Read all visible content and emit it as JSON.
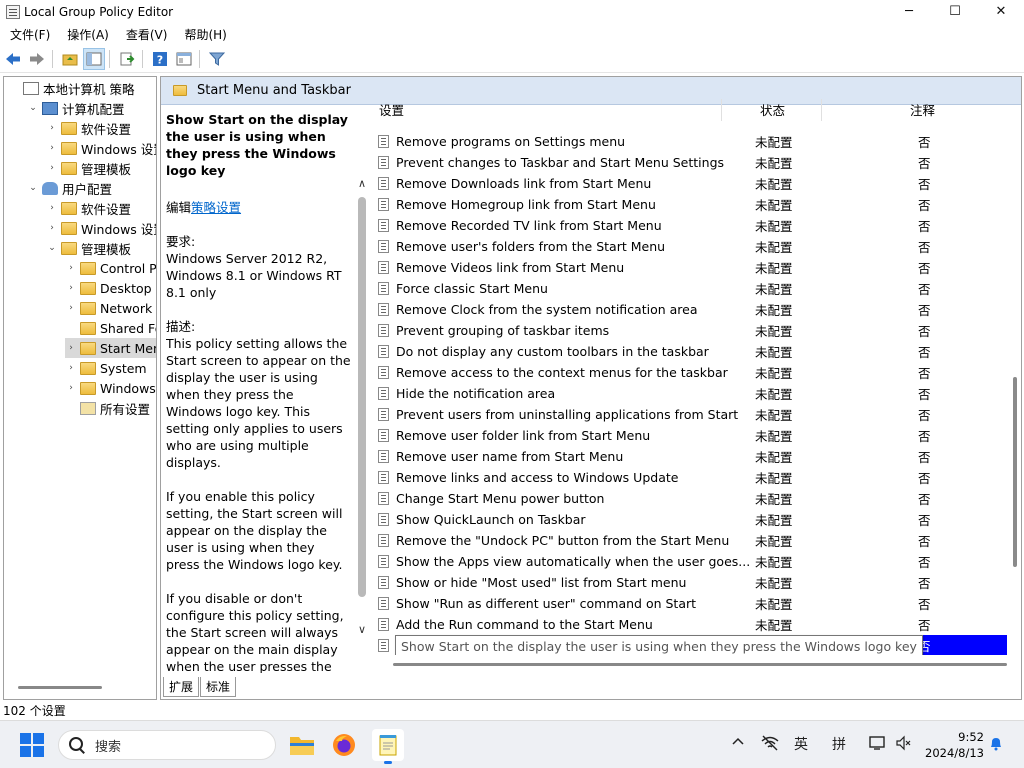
{
  "window": {
    "title": "Local Group Policy Editor",
    "controls": {
      "minimize": "─",
      "maximize": "☐",
      "close": "✕"
    }
  },
  "menu": [
    "文件(F)",
    "操作(A)",
    "查看(V)",
    "帮助(H)"
  ],
  "tree": {
    "items": [
      {
        "label": "本地计算机 策略",
        "depth": 0,
        "arrow": "",
        "icon": "computer-policy-icon"
      },
      {
        "label": "计算机配置",
        "depth": 1,
        "arrow": "⌄",
        "icon": "computer-icon"
      },
      {
        "label": "软件设置",
        "depth": 2,
        "arrow": "›",
        "icon": "folder-icon"
      },
      {
        "label": "Windows 设置",
        "depth": 2,
        "arrow": "›",
        "icon": "folder-icon"
      },
      {
        "label": "管理模板",
        "depth": 2,
        "arrow": "›",
        "icon": "folder-icon"
      },
      {
        "label": "用户配置",
        "depth": 1,
        "arrow": "⌄",
        "icon": "user-icon"
      },
      {
        "label": "软件设置",
        "depth": 2,
        "arrow": "›",
        "icon": "folder-icon"
      },
      {
        "label": "Windows 设置",
        "depth": 2,
        "arrow": "›",
        "icon": "folder-icon"
      },
      {
        "label": "管理模板",
        "depth": 2,
        "arrow": "⌄",
        "icon": "folder-icon"
      },
      {
        "label": "Control Pane",
        "depth": 3,
        "arrow": "›",
        "icon": "folder-icon"
      },
      {
        "label": "Desktop",
        "depth": 3,
        "arrow": "›",
        "icon": "folder-icon"
      },
      {
        "label": "Network",
        "depth": 3,
        "arrow": "›",
        "icon": "folder-icon"
      },
      {
        "label": "Shared Fold",
        "depth": 3,
        "arrow": "",
        "icon": "folder-icon"
      },
      {
        "label": "Start Menu a",
        "depth": 3,
        "arrow": "›",
        "icon": "folder-icon",
        "selected": true
      },
      {
        "label": "System",
        "depth": 3,
        "arrow": "›",
        "icon": "folder-icon"
      },
      {
        "label": "Windows Co",
        "depth": 3,
        "arrow": "›",
        "icon": "folder-icon"
      },
      {
        "label": "所有设置",
        "depth": 3,
        "arrow": "",
        "icon": "all-settings-icon"
      }
    ]
  },
  "header": {
    "title": "Start Menu and Taskbar"
  },
  "description": {
    "title": "Show Start on the display the user is using when they press the Windows logo key",
    "edit_prefix": "编辑",
    "edit_link": "策略设置",
    "requirements_label": "要求:",
    "requirements": "Windows Server 2012 R2, Windows 8.1 or Windows RT 8.1 only",
    "description_label": "描述:",
    "para1": "This policy setting allows the Start screen to appear on the display the user is using when they press the Windows logo key. This setting only applies to users who are using multiple displays.",
    "para2": "If you enable this policy setting, the Start screen will appear on the display the user is using when they press the Windows logo key.",
    "para3": "If you disable or don't configure this policy setting, the Start screen will always appear on the main display when the user presses the Windows logo key. Users will still be able to open Start on"
  },
  "tabs": [
    "扩展",
    "标准"
  ],
  "list": {
    "columns": {
      "setting": "设置",
      "state": "状态",
      "note": "注释"
    },
    "rows": [
      {
        "name": "Remove programs on Settings menu",
        "state": "未配置",
        "note": "否"
      },
      {
        "name": "Prevent changes to Taskbar and Start Menu Settings",
        "state": "未配置",
        "note": "否"
      },
      {
        "name": "Remove Downloads link from Start Menu",
        "state": "未配置",
        "note": "否"
      },
      {
        "name": "Remove Homegroup link from Start Menu",
        "state": "未配置",
        "note": "否"
      },
      {
        "name": "Remove Recorded TV link from Start Menu",
        "state": "未配置",
        "note": "否"
      },
      {
        "name": "Remove user's folders from the Start Menu",
        "state": "未配置",
        "note": "否"
      },
      {
        "name": "Remove Videos link from Start Menu",
        "state": "未配置",
        "note": "否"
      },
      {
        "name": "Force classic Start Menu",
        "state": "未配置",
        "note": "否"
      },
      {
        "name": "Remove Clock from the system notification area",
        "state": "未配置",
        "note": "否"
      },
      {
        "name": "Prevent grouping of taskbar items",
        "state": "未配置",
        "note": "否"
      },
      {
        "name": "Do not display any custom toolbars in the taskbar",
        "state": "未配置",
        "note": "否"
      },
      {
        "name": "Remove access to the context menus for the taskbar",
        "state": "未配置",
        "note": "否"
      },
      {
        "name": "Hide the notification area",
        "state": "未配置",
        "note": "否"
      },
      {
        "name": "Prevent users from uninstalling applications from Start",
        "state": "未配置",
        "note": "否"
      },
      {
        "name": "Remove user folder link from Start Menu",
        "state": "未配置",
        "note": "否"
      },
      {
        "name": "Remove user name from Start Menu",
        "state": "未配置",
        "note": "否"
      },
      {
        "name": "Remove links and access to Windows Update",
        "state": "未配置",
        "note": "否"
      },
      {
        "name": "Change Start Menu power button",
        "state": "未配置",
        "note": "否"
      },
      {
        "name": "Show QuickLaunch on Taskbar",
        "state": "未配置",
        "note": "否"
      },
      {
        "name": "Remove the \"Undock PC\" button from the Start Menu",
        "state": "未配置",
        "note": "否"
      },
      {
        "name": "Show the Apps view automatically when the user goes...",
        "state": "未配置",
        "note": "否"
      },
      {
        "name": "Show or hide \"Most used\" list from Start menu",
        "state": "未配置",
        "note": "否"
      },
      {
        "name": "Show \"Run as different user\" command on Start",
        "state": "未配置",
        "note": "否"
      },
      {
        "name": "Add the Run command to the Start Menu",
        "state": "未配置",
        "note": "否"
      },
      {
        "name": "Show Start on the display the user is using when they press the Windows logo key",
        "state": "",
        "note": "否",
        "selected": true
      }
    ],
    "tooltip": "Show Start on the display the user is using when they press the Windows logo key"
  },
  "status": {
    "text": "102 个设置"
  },
  "taskbar": {
    "search_placeholder": "搜索",
    "tray_lang1": "英",
    "tray_lang2": "拼",
    "time": "9:52",
    "date": "2024/8/13"
  },
  "colors": {
    "selection": "#0000ff",
    "header_band": "#dbe6f4",
    "link": "#0066cc",
    "accent": "#1a73e8"
  }
}
